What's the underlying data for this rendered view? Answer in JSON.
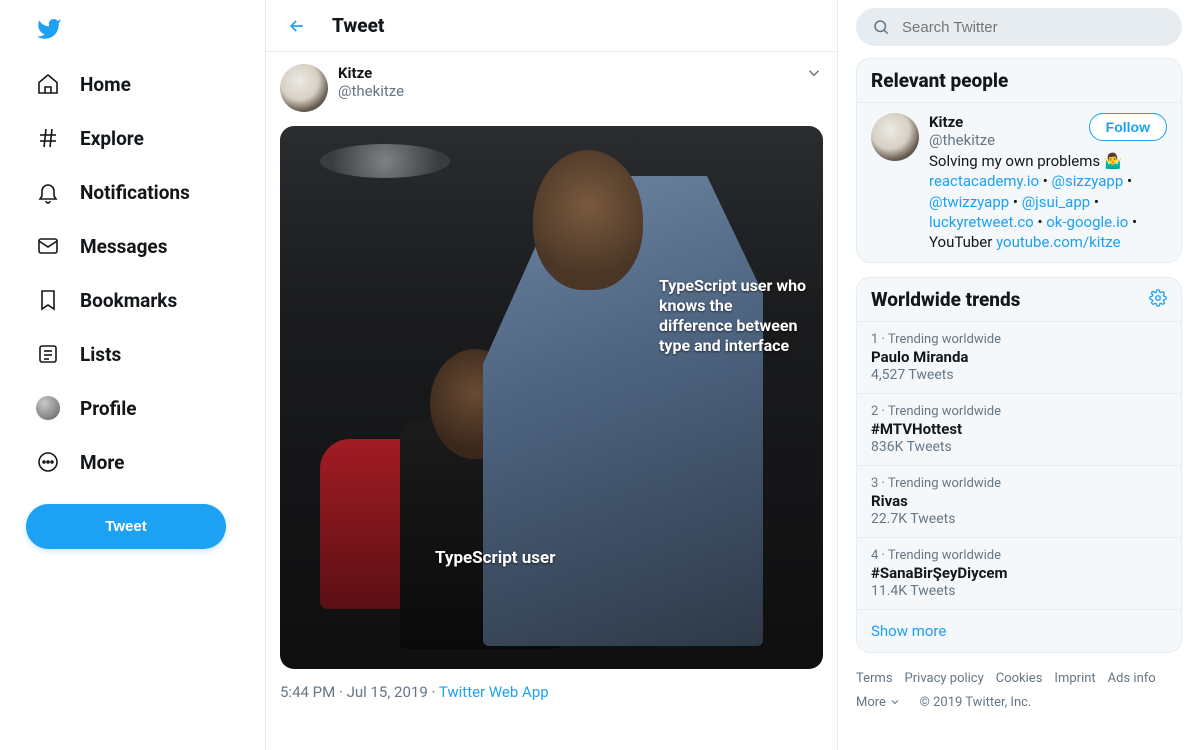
{
  "colors": {
    "accent": "#1da1f2",
    "muted": "#657786"
  },
  "sidebar": {
    "items": [
      {
        "label": "Home"
      },
      {
        "label": "Explore"
      },
      {
        "label": "Notifications"
      },
      {
        "label": "Messages"
      },
      {
        "label": "Bookmarks"
      },
      {
        "label": "Lists"
      },
      {
        "label": "Profile"
      },
      {
        "label": "More"
      }
    ],
    "tweet_button": "Tweet"
  },
  "header": {
    "title": "Tweet"
  },
  "tweet": {
    "author_name": "Kitze",
    "author_handle": "@thekitze",
    "image_captions": {
      "low": "TypeScript user",
      "high": "TypeScript user who knows the difference between type and interface"
    },
    "time": "5:44 PM",
    "date_sep": " · ",
    "date": "Jul 15, 2019",
    "source_sep": " · ",
    "source": "Twitter Web App"
  },
  "search": {
    "placeholder": "Search Twitter"
  },
  "relevant": {
    "title": "Relevant people",
    "follow_label": "Follow",
    "person": {
      "name": "Kitze",
      "handle": "@thekitze",
      "bio_prefix": "Solving my own problems 🤷‍♂️ ",
      "links": [
        "reactacademy.io",
        "@sizzyapp",
        "@twizzyapp",
        "@jsui_app",
        "luckyretweet.co",
        "ok-google.io"
      ],
      "sep": " • ",
      "bio_mid": "YouTuber ",
      "yt": "youtube.com/kitze"
    }
  },
  "trends": {
    "title": "Worldwide trends",
    "items": [
      {
        "rank": "1",
        "meta": "Trending worldwide",
        "name": "Paulo Miranda",
        "count": "4,527 Tweets"
      },
      {
        "rank": "2",
        "meta": "Trending worldwide",
        "name": "#MTVHottest",
        "count": "836K Tweets"
      },
      {
        "rank": "3",
        "meta": "Trending worldwide",
        "name": "Rivas",
        "count": "22.7K Tweets"
      },
      {
        "rank": "4",
        "meta": "Trending worldwide",
        "name": "#SanaBirŞeyDiycem",
        "count": "11.4K Tweets"
      }
    ],
    "show_more": "Show more"
  },
  "footer": {
    "links": [
      "Terms",
      "Privacy policy",
      "Cookies",
      "Imprint",
      "Ads info"
    ],
    "more": "More",
    "copyright": "© 2019 Twitter, Inc."
  }
}
